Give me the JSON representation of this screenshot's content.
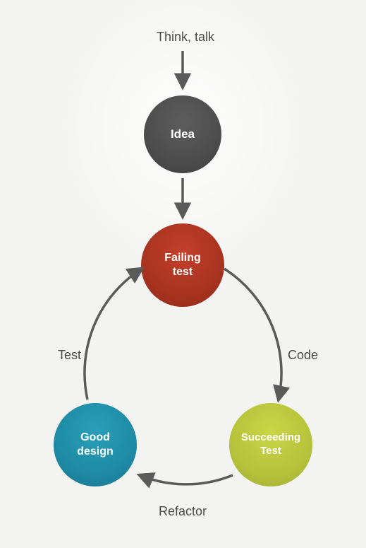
{
  "diagram": {
    "topLabel": "Think, talk",
    "nodes": {
      "idea": "Idea",
      "failing": "Failing\ntest",
      "succeeding": "Succeeding\nTest",
      "good": "Good\ndesign"
    },
    "edgeLabels": {
      "code": "Code",
      "refactor": "Refactor",
      "test": "Test"
    },
    "colors": {
      "idea": "#4e4e4e",
      "failing": "#a83320",
      "succeeding": "#b7c23c",
      "good": "#1f8aa4",
      "arrow": "#5a5a5a",
      "text": "#4a4a4a",
      "background": "#f3f3f1"
    }
  }
}
